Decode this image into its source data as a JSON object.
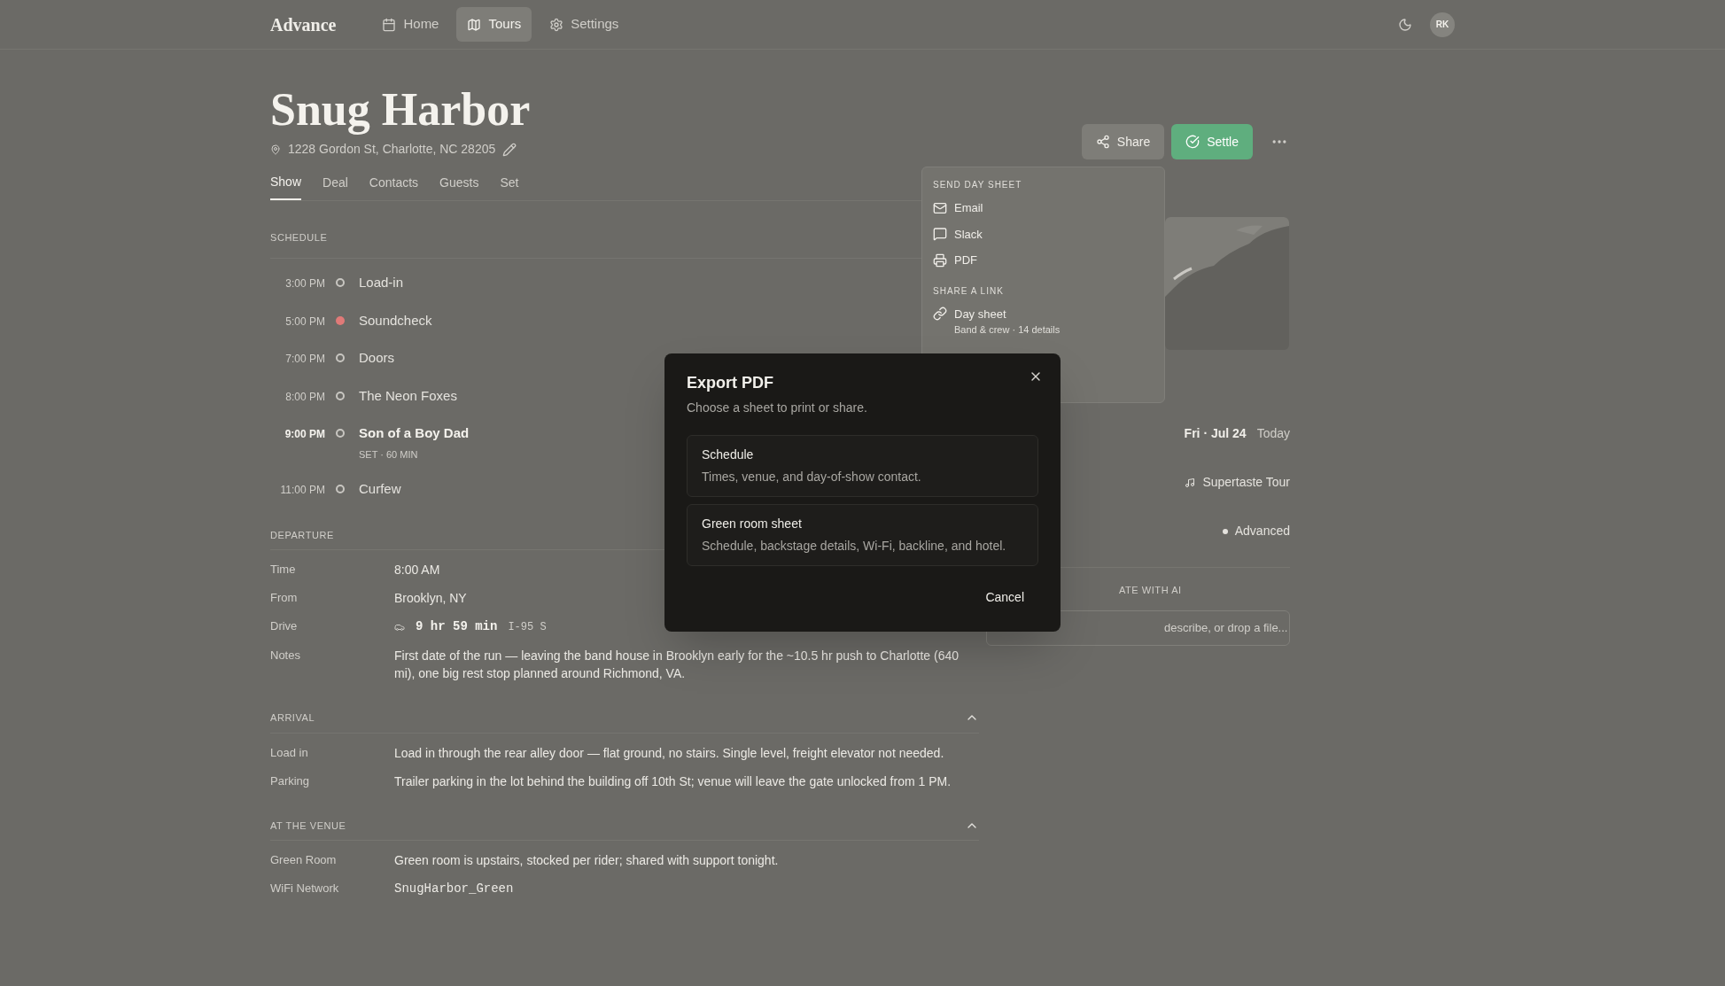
{
  "nav": {
    "logo": "Advance",
    "items": [
      {
        "label": "Home",
        "selected": false
      },
      {
        "label": "Tours",
        "selected": true
      },
      {
        "label": "Settings",
        "selected": false
      }
    ],
    "avatar": "RK"
  },
  "venue": {
    "title": "Snug Harbor",
    "address": "1228 Gordon St, Charlotte, NC 28205"
  },
  "tabs": [
    {
      "label": "Show",
      "selected": true
    },
    {
      "label": "Deal",
      "selected": false
    },
    {
      "label": "Contacts",
      "selected": false
    },
    {
      "label": "Guests",
      "selected": false
    },
    {
      "label": "Set",
      "selected": false
    }
  ],
  "actions": {
    "share": "Share",
    "settle": "Settle"
  },
  "share_menu": {
    "sections": [
      {
        "heading": "SEND DAY SHEET",
        "items": [
          {
            "label": "Email"
          },
          {
            "label": "Slack"
          },
          {
            "label": "PDF"
          }
        ]
      },
      {
        "heading": "SHARE A LINK",
        "items": [
          {
            "label": "Day sheet",
            "sub": "Band & crew · 14 details"
          }
        ]
      }
    ]
  },
  "schedule": {
    "heading": "SCHEDULE",
    "rows": [
      {
        "time": "3:00 PM",
        "label": "Load-in",
        "current": false,
        "bold": false
      },
      {
        "time": "5:00 PM",
        "label": "Soundcheck",
        "current": true,
        "bold": false
      },
      {
        "time": "7:00 PM",
        "label": "Doors",
        "current": false,
        "bold": false
      },
      {
        "time": "8:00 PM",
        "label": "The Neon Foxes",
        "current": false,
        "bold": false
      },
      {
        "time": "9:00 PM",
        "label": "Son of a Boy Dad",
        "current": false,
        "bold": true,
        "sub": "SET · 60 MIN"
      },
      {
        "time": "11:00 PM",
        "label": "Curfew",
        "current": false,
        "bold": false
      }
    ]
  },
  "sections": [
    {
      "heading": "DEPARTURE",
      "rows": [
        {
          "label": "Time",
          "value": "8:00 AM"
        },
        {
          "label": "From",
          "value": "Brooklyn, NY"
        },
        {
          "label": "Drive",
          "value": "9 hr 59 min",
          "kind": "drive",
          "extra": "I-95 S"
        },
        {
          "label": "Notes",
          "value": "First date of the run — leaving the band house in Brooklyn early for the ~10.5 hr push to Charlotte (640 mi), one big rest stop planned around Richmond, VA."
        }
      ]
    },
    {
      "heading": "ARRIVAL",
      "collapsible": true,
      "rows": [
        {
          "label": "Load in",
          "value": "Load in through the rear alley door — flat ground, no stairs. Single level, freight elevator not needed."
        },
        {
          "label": "Parking",
          "value": "Trailer parking in the lot behind the building off 10th St; venue will leave the gate unlocked from 1 PM."
        }
      ]
    },
    {
      "heading": "AT THE VENUE",
      "collapsible": true,
      "rows": [
        {
          "label": "Green Room",
          "value": "Green room is upstairs, stocked per rider; shared with support tonight."
        },
        {
          "label": "WiFi Network",
          "value": "SnugHarbor_Green",
          "kind": "mono"
        }
      ]
    }
  ],
  "side": {
    "date": "Fri · Jul 24",
    "today": "Today",
    "tour": "Supertaste Tour",
    "status": "Advanced",
    "ai_heading": "ATE WITH AI",
    "ai_placeholder": "describe, or drop a file..."
  },
  "dialog": {
    "title": "Export PDF",
    "subtitle": "Choose a sheet to print or share.",
    "options": [
      {
        "label": "Schedule",
        "description": "Times, venue, and day-of-show contact."
      },
      {
        "label": "Green room sheet",
        "description": "Schedule, backstage details, Wi-Fi, backline, and hotel."
      }
    ],
    "cancel": "Cancel"
  }
}
